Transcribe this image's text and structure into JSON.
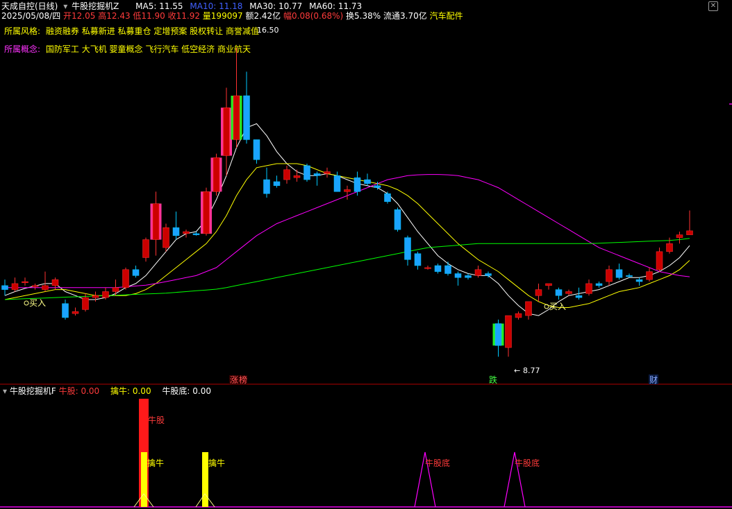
{
  "header": {
    "stock_name": "天成自控(日线)",
    "indicator_name": "牛股挖掘机Z",
    "ma5": "MA5: 11.55",
    "ma10": "MA10: 11.18",
    "ma30": "MA30: 10.77",
    "ma60": "MA60: 11.73",
    "date": "2025/05/08/四",
    "open": "开12.05",
    "high": "高12.43",
    "low": "低11.90",
    "close": "收11.92",
    "volume": "量199097",
    "amount": "额2.42亿",
    "change": "幅0.08(0.68%)",
    "turnover": "换5.38%",
    "float_value": "流通3.70亿",
    "industry": "汽车配件"
  },
  "tags": {
    "style_label": "所属风格:",
    "style_values": "融资融券 私募新进 私募重仓 定增预案 股权转让 商誉减值",
    "concept_label": "所属概念:",
    "concept_values": "国防军工 大飞机 婴童概念 飞行汽车 低空经济 商业航天"
  },
  "price_labels": {
    "high_mark": "16.50",
    "low_mark": "8.77",
    "buy_label_1": "买入",
    "buy_label_2": "买入"
  },
  "markers": {
    "limit_up": "涨",
    "limit_up_2": "榜",
    "limit_down": "跌",
    "finance": "财"
  },
  "sub_panel": {
    "name": "牛股挖掘机F",
    "niugu": "牛股: 0.00",
    "qiniu": "擒牛: 0.00",
    "niugudi": "牛股底: 0.00",
    "label_niugu": "牛股",
    "label_qiniu_1": "擒牛",
    "label_qiniu_2": "擒牛",
    "label_niugudi_1": "牛股底",
    "label_niugudi_2": "牛股底"
  },
  "colors": {
    "up": "#ff3232",
    "down": "#00c8ff",
    "ma5": "#ffffff",
    "ma10": "#ffff00",
    "ma30": "#ff00ff",
    "ma60": "#00ff00",
    "signal_yellow": "#ffff00",
    "signal_pink": "#ff3399",
    "signal_green": "#22ee22"
  },
  "chart_data": {
    "type": "candlestick",
    "candles": [
      {
        "o": 10.55,
        "h": 10.7,
        "l": 10.3,
        "c": 10.45
      },
      {
        "o": 10.45,
        "h": 10.75,
        "l": 10.4,
        "c": 10.6
      },
      {
        "o": 10.62,
        "h": 10.75,
        "l": 10.55,
        "c": 10.65
      },
      {
        "o": 10.55,
        "h": 10.6,
        "l": 10.45,
        "c": 10.55
      },
      {
        "o": 10.45,
        "h": 10.9,
        "l": 10.4,
        "c": 10.55
      },
      {
        "o": 10.55,
        "h": 10.75,
        "l": 10.45,
        "c": 10.7
      },
      {
        "o": 10.1,
        "h": 10.2,
        "l": 9.7,
        "c": 9.75
      },
      {
        "o": 9.85,
        "h": 10.0,
        "l": 9.8,
        "c": 9.9
      },
      {
        "o": 9.95,
        "h": 10.35,
        "l": 9.9,
        "c": 10.25
      },
      {
        "o": 10.25,
        "h": 10.4,
        "l": 10.15,
        "c": 10.3
      },
      {
        "o": 10.25,
        "h": 10.5,
        "l": 10.2,
        "c": 10.4
      },
      {
        "o": 10.4,
        "h": 10.7,
        "l": 10.3,
        "c": 10.5
      },
      {
        "o": 10.5,
        "h": 11.0,
        "l": 10.45,
        "c": 10.95
      },
      {
        "o": 10.95,
        "h": 11.05,
        "l": 10.75,
        "c": 10.8
      },
      {
        "o": 11.25,
        "h": 11.75,
        "l": 11.15,
        "c": 11.7
      },
      {
        "o": 11.7,
        "h": 12.9,
        "l": 11.3,
        "c": 12.6
      },
      {
        "o": 11.5,
        "h": 12.1,
        "l": 11.4,
        "c": 12.0
      },
      {
        "o": 12.0,
        "h": 12.4,
        "l": 11.7,
        "c": 11.8
      },
      {
        "o": 11.85,
        "h": 11.95,
        "l": 11.75,
        "c": 11.9
      },
      {
        "o": 11.85,
        "h": 11.9,
        "l": 11.8,
        "c": 11.82
      },
      {
        "o": 11.85,
        "h": 13.0,
        "l": 11.8,
        "c": 12.9
      },
      {
        "o": 12.9,
        "h": 13.85,
        "l": 12.8,
        "c": 13.75
      },
      {
        "o": 13.8,
        "h": 15.5,
        "l": 13.3,
        "c": 15.0
      },
      {
        "o": 14.2,
        "h": 16.5,
        "l": 14.0,
        "c": 15.3
      },
      {
        "o": 15.3,
        "h": 15.9,
        "l": 14.1,
        "c": 14.2
      },
      {
        "o": 14.2,
        "h": 14.2,
        "l": 13.6,
        "c": 13.7
      },
      {
        "o": 13.2,
        "h": 13.5,
        "l": 12.75,
        "c": 12.85
      },
      {
        "o": 13.15,
        "h": 13.3,
        "l": 13.0,
        "c": 13.05
      },
      {
        "o": 13.2,
        "h": 13.55,
        "l": 13.1,
        "c": 13.45
      },
      {
        "o": 13.25,
        "h": 13.45,
        "l": 13.15,
        "c": 13.3
      },
      {
        "o": 13.55,
        "h": 13.6,
        "l": 13.15,
        "c": 13.2
      },
      {
        "o": 13.35,
        "h": 13.4,
        "l": 13.05,
        "c": 13.3
      },
      {
        "o": 13.35,
        "h": 13.5,
        "l": 13.25,
        "c": 13.4
      },
      {
        "o": 13.3,
        "h": 13.4,
        "l": 12.9,
        "c": 12.9
      },
      {
        "o": 12.9,
        "h": 13.05,
        "l": 12.7,
        "c": 12.95
      },
      {
        "o": 13.25,
        "h": 13.4,
        "l": 12.8,
        "c": 12.9
      },
      {
        "o": 13.2,
        "h": 13.35,
        "l": 13.05,
        "c": 13.1
      },
      {
        "o": 13.05,
        "h": 13.15,
        "l": 12.95,
        "c": 13.0
      },
      {
        "o": 12.85,
        "h": 12.9,
        "l": 12.6,
        "c": 12.65
      },
      {
        "o": 12.45,
        "h": 12.5,
        "l": 11.9,
        "c": 11.95
      },
      {
        "o": 11.75,
        "h": 11.8,
        "l": 11.05,
        "c": 11.2
      },
      {
        "o": 11.35,
        "h": 11.4,
        "l": 10.95,
        "c": 11.05
      },
      {
        "o": 11.0,
        "h": 11.05,
        "l": 10.95,
        "c": 11.0
      },
      {
        "o": 11.05,
        "h": 11.1,
        "l": 10.85,
        "c": 10.9
      },
      {
        "o": 11.05,
        "h": 11.15,
        "l": 10.8,
        "c": 10.85
      },
      {
        "o": 10.85,
        "h": 10.9,
        "l": 10.55,
        "c": 10.75
      },
      {
        "o": 10.8,
        "h": 10.85,
        "l": 10.7,
        "c": 10.75
      },
      {
        "o": 10.8,
        "h": 11.05,
        "l": 10.75,
        "c": 10.95
      },
      {
        "o": 10.85,
        "h": 10.9,
        "l": 10.75,
        "c": 10.8
      },
      {
        "o": 9.6,
        "h": 9.7,
        "l": 8.77,
        "c": 9.05
      },
      {
        "o": 9.0,
        "h": 9.75,
        "l": 8.77,
        "c": 9.8
      },
      {
        "o": 9.75,
        "h": 9.9,
        "l": 9.7,
        "c": 9.85
      },
      {
        "o": 9.8,
        "h": 10.15,
        "l": 9.7,
        "c": 10.15
      },
      {
        "o": 10.3,
        "h": 10.6,
        "l": 10.15,
        "c": 10.45
      },
      {
        "o": 10.55,
        "h": 10.6,
        "l": 10.45,
        "c": 10.6
      },
      {
        "o": 10.45,
        "h": 10.5,
        "l": 10.2,
        "c": 10.3
      },
      {
        "o": 10.35,
        "h": 10.45,
        "l": 10.3,
        "c": 10.4
      },
      {
        "o": 10.3,
        "h": 10.5,
        "l": 10.2,
        "c": 10.25
      },
      {
        "o": 10.35,
        "h": 10.7,
        "l": 10.3,
        "c": 10.6
      },
      {
        "o": 10.6,
        "h": 10.65,
        "l": 10.5,
        "c": 10.55
      },
      {
        "o": 10.65,
        "h": 11.05,
        "l": 10.55,
        "c": 10.95
      },
      {
        "o": 10.95,
        "h": 11.1,
        "l": 10.7,
        "c": 10.75
      },
      {
        "o": 10.8,
        "h": 10.85,
        "l": 10.75,
        "c": 10.78
      },
      {
        "o": 10.7,
        "h": 10.75,
        "l": 10.55,
        "c": 10.65
      },
      {
        "o": 10.7,
        "h": 11.0,
        "l": 10.65,
        "c": 10.9
      },
      {
        "o": 10.95,
        "h": 11.5,
        "l": 10.9,
        "c": 11.4
      },
      {
        "o": 11.4,
        "h": 11.75,
        "l": 11.35,
        "c": 11.6
      },
      {
        "o": 11.75,
        "h": 11.9,
        "l": 11.6,
        "c": 11.82
      },
      {
        "o": 11.82,
        "h": 12.43,
        "l": 11.9,
        "c": 11.92
      }
    ],
    "ma_lines": [
      {
        "name": "MA5",
        "color": "#ffffff",
        "values": [
          10.3,
          10.4,
          10.48,
          10.54,
          10.6,
          10.6,
          10.4,
          10.3,
          10.2,
          10.2,
          10.25,
          10.35,
          10.5,
          10.6,
          10.8,
          11.1,
          11.4,
          11.7,
          11.85,
          11.9,
          12.2,
          12.7,
          13.3,
          14.0,
          14.5,
          14.6,
          14.3,
          13.9,
          13.6,
          13.4,
          13.3,
          13.3,
          13.35,
          13.3,
          13.2,
          13.1,
          13.05,
          13.0,
          12.85,
          12.6,
          12.25,
          11.9,
          11.6,
          11.3,
          11.1,
          10.95,
          10.85,
          10.8,
          10.8,
          10.6,
          10.3,
          10.05,
          9.85,
          9.8,
          9.95,
          10.15,
          10.3,
          10.35,
          10.4,
          10.45,
          10.55,
          10.65,
          10.75,
          10.75,
          10.8,
          10.9,
          11.05,
          11.25,
          11.55
        ]
      },
      {
        "name": "MA10",
        "color": "#ffff00",
        "values": [
          10.2,
          10.25,
          10.3,
          10.35,
          10.4,
          10.45,
          10.45,
          10.4,
          10.35,
          10.3,
          10.3,
          10.3,
          10.3,
          10.35,
          10.45,
          10.6,
          10.8,
          11.0,
          11.2,
          11.4,
          11.6,
          11.9,
          12.3,
          12.8,
          13.2,
          13.5,
          13.55,
          13.6,
          13.6,
          13.6,
          13.55,
          13.45,
          13.35,
          13.3,
          13.25,
          13.2,
          13.15,
          13.1,
          13.05,
          12.95,
          12.8,
          12.6,
          12.35,
          12.1,
          11.85,
          11.6,
          11.4,
          11.2,
          11.05,
          10.9,
          10.7,
          10.5,
          10.3,
          10.15,
          10.05,
          10.0,
          10.0,
          10.05,
          10.1,
          10.2,
          10.3,
          10.4,
          10.45,
          10.5,
          10.6,
          10.7,
          10.8,
          10.95,
          11.18
        ]
      },
      {
        "name": "MA30",
        "color": "#ff00ff",
        "values": [
          10.5,
          10.5,
          10.5,
          10.5,
          10.5,
          10.5,
          10.5,
          10.5,
          10.5,
          10.5,
          10.5,
          10.5,
          10.52,
          10.54,
          10.56,
          10.6,
          10.65,
          10.7,
          10.75,
          10.8,
          10.9,
          11.0,
          11.2,
          11.4,
          11.6,
          11.8,
          11.95,
          12.1,
          12.2,
          12.3,
          12.4,
          12.5,
          12.6,
          12.7,
          12.8,
          12.9,
          13.0,
          13.1,
          13.2,
          13.25,
          13.3,
          13.32,
          13.33,
          13.33,
          13.32,
          13.3,
          13.25,
          13.2,
          13.1,
          13.0,
          12.85,
          12.7,
          12.55,
          12.4,
          12.25,
          12.1,
          11.95,
          11.8,
          11.65,
          11.5,
          11.4,
          11.3,
          11.2,
          11.1,
          11.0,
          10.9,
          10.85,
          10.8,
          10.77
        ]
      },
      {
        "name": "MA60",
        "color": "#00ff00",
        "values": [
          10.2,
          10.21,
          10.22,
          10.23,
          10.24,
          10.25,
          10.26,
          10.27,
          10.28,
          10.29,
          10.3,
          10.31,
          10.32,
          10.33,
          10.34,
          10.35,
          10.36,
          10.38,
          10.4,
          10.42,
          10.44,
          10.46,
          10.5,
          10.55,
          10.6,
          10.65,
          10.7,
          10.75,
          10.8,
          10.85,
          10.9,
          10.95,
          11.0,
          11.05,
          11.1,
          11.15,
          11.2,
          11.25,
          11.3,
          11.35,
          11.4,
          11.45,
          11.5,
          11.52,
          11.54,
          11.56,
          11.58,
          11.6,
          11.6,
          11.6,
          11.6,
          11.6,
          11.6,
          11.6,
          11.6,
          11.6,
          11.6,
          11.6,
          11.6,
          11.61,
          11.62,
          11.63,
          11.64,
          11.65,
          11.66,
          11.67,
          11.68,
          11.7,
          11.73
        ]
      }
    ],
    "signal_bars": {
      "yellow": [
        15,
        20
      ],
      "pink": [
        15,
        20,
        21,
        22
      ],
      "green": [
        23,
        49
      ]
    },
    "ylim": [
      8.5,
      17.0
    ]
  }
}
